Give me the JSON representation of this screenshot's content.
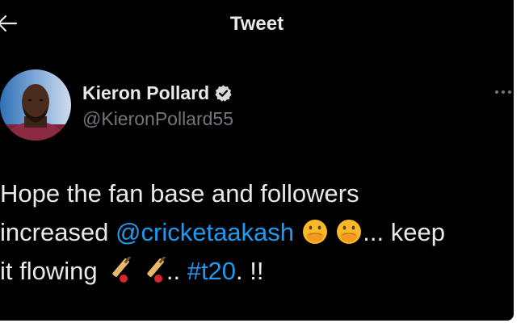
{
  "header": {
    "title": "Tweet",
    "back_icon": "back-arrow-icon"
  },
  "author": {
    "display_name": "Kieron Pollard",
    "handle": "@KieronPollard55",
    "verified": true,
    "verified_icon": "verified-badge-icon"
  },
  "tweet": {
    "line1": "Hope the fan base and followers",
    "line2_prefix": "increased ",
    "mention": "@cricketaakash",
    "line2_suffix": "... keep",
    "line3_prefix": "it flowing ",
    "line3_mid": ".. ",
    "hashtag": "#t20",
    "line3_suffix": ". !!",
    "emoji_after_mention": [
      "face-with-hand-over-mouth",
      "face-with-hand-over-mouth"
    ],
    "emoji_after_flowing": [
      "cricket-bat-and-ball",
      "cricket-bat-and-ball"
    ]
  },
  "colors": {
    "background": "#000000",
    "text": "#e7e9ea",
    "secondary_text": "#71767b",
    "link": "#1d9bf0",
    "verified_badge": "#d9d9d9"
  }
}
